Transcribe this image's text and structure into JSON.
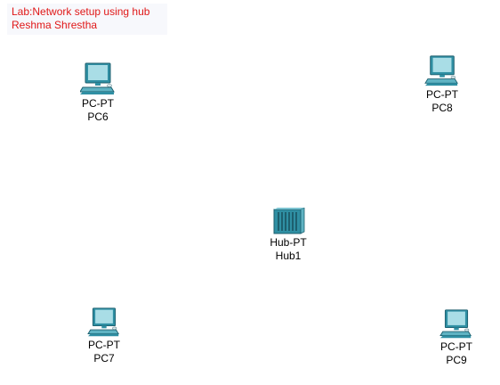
{
  "note": {
    "line1": "Lab:Network setup using hub",
    "line2": "Reshma Shrestha"
  },
  "devices": [
    {
      "id": "pc6",
      "model": "PC-PT",
      "name": "PC6",
      "icon": "pc-icon"
    },
    {
      "id": "pc8",
      "model": "PC-PT",
      "name": "PC8",
      "icon": "pc-icon"
    },
    {
      "id": "hub1",
      "model": "Hub-PT",
      "name": "Hub1",
      "icon": "hub-icon"
    },
    {
      "id": "pc7",
      "model": "PC-PT",
      "name": "PC7",
      "icon": "pc-icon"
    },
    {
      "id": "pc9",
      "model": "PC-PT",
      "name": "PC9",
      "icon": "pc-icon"
    }
  ],
  "colors": {
    "note_text": "#e01818",
    "note_bg": "#f7f8fc",
    "device_teal": "#2f8fa3",
    "screen": "#a9dde6"
  }
}
